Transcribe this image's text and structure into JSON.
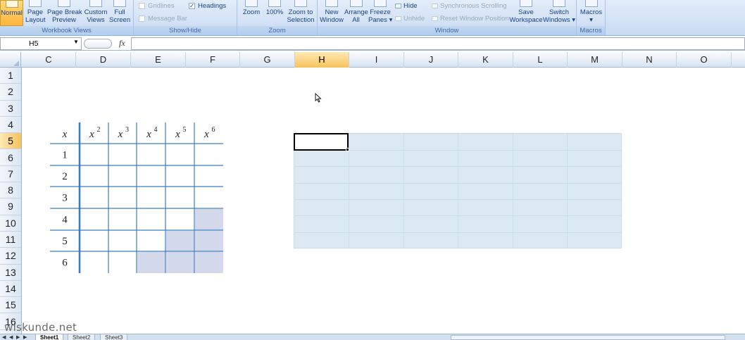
{
  "ribbon": {
    "workbook_views": {
      "label": "Workbook Views",
      "normal": "Normal",
      "page_layout": [
        "Page",
        "Layout"
      ],
      "page_break": [
        "Page Break",
        "Preview"
      ],
      "custom_views": [
        "Custom",
        "Views"
      ],
      "full_screen": [
        "Full",
        "Screen"
      ]
    },
    "show_hide": {
      "label": "Show/Hide",
      "gridlines": "Gridlines",
      "headings": "Headings",
      "message_bar": "Message Bar",
      "headings_checked": "✓"
    },
    "zoom": {
      "label": "Zoom",
      "zoom": "Zoom",
      "hundred": "100%",
      "zoom_selection": [
        "Zoom to",
        "Selection"
      ]
    },
    "window": {
      "label": "Window",
      "new_window": [
        "New",
        "Window"
      ],
      "arrange_all": [
        "Arrange",
        "All"
      ],
      "freeze_panes": [
        "Freeze",
        "Panes ▾"
      ],
      "hide": "Hide",
      "unhide": "Unhide",
      "sync_scrolling": "Synchronous Scrolling",
      "reset_position": "Reset Window Position",
      "save_workspace": [
        "Save",
        "Workspace"
      ],
      "switch_windows": [
        "Switch",
        "Windows ▾"
      ]
    },
    "macros": {
      "label": "Macros",
      "macros": "Macros",
      "arrow": "▾"
    }
  },
  "formula_bar": {
    "name_box": "H5",
    "name_arrow": "▼",
    "fx": "fx",
    "formula": ""
  },
  "grid": {
    "columns": [
      "C",
      "D",
      "E",
      "F",
      "G",
      "H",
      "I",
      "J",
      "K",
      "L",
      "M",
      "N",
      "O"
    ],
    "selected_column": "H",
    "rows": [
      "1",
      "2",
      "3",
      "4",
      "5",
      "6",
      "7",
      "8",
      "9",
      "10",
      "11",
      "12",
      "13",
      "14",
      "15",
      "16"
    ],
    "selected_row": "5"
  },
  "power_table": {
    "header_x": "x",
    "header_powers": [
      "2",
      "3",
      "4",
      "5",
      "6"
    ],
    "row_values": [
      "1",
      "2",
      "3",
      "4",
      "5",
      "6"
    ],
    "shaded_color": "#d3d8ea",
    "line_color": "#3a7cc0"
  },
  "sheet_tabs": [
    "Sheet1",
    "Sheet2",
    "Sheet3"
  ],
  "nav_arrows": [
    "◀",
    "◀",
    "▶",
    "▶"
  ],
  "watermark": "wiskunde.net"
}
